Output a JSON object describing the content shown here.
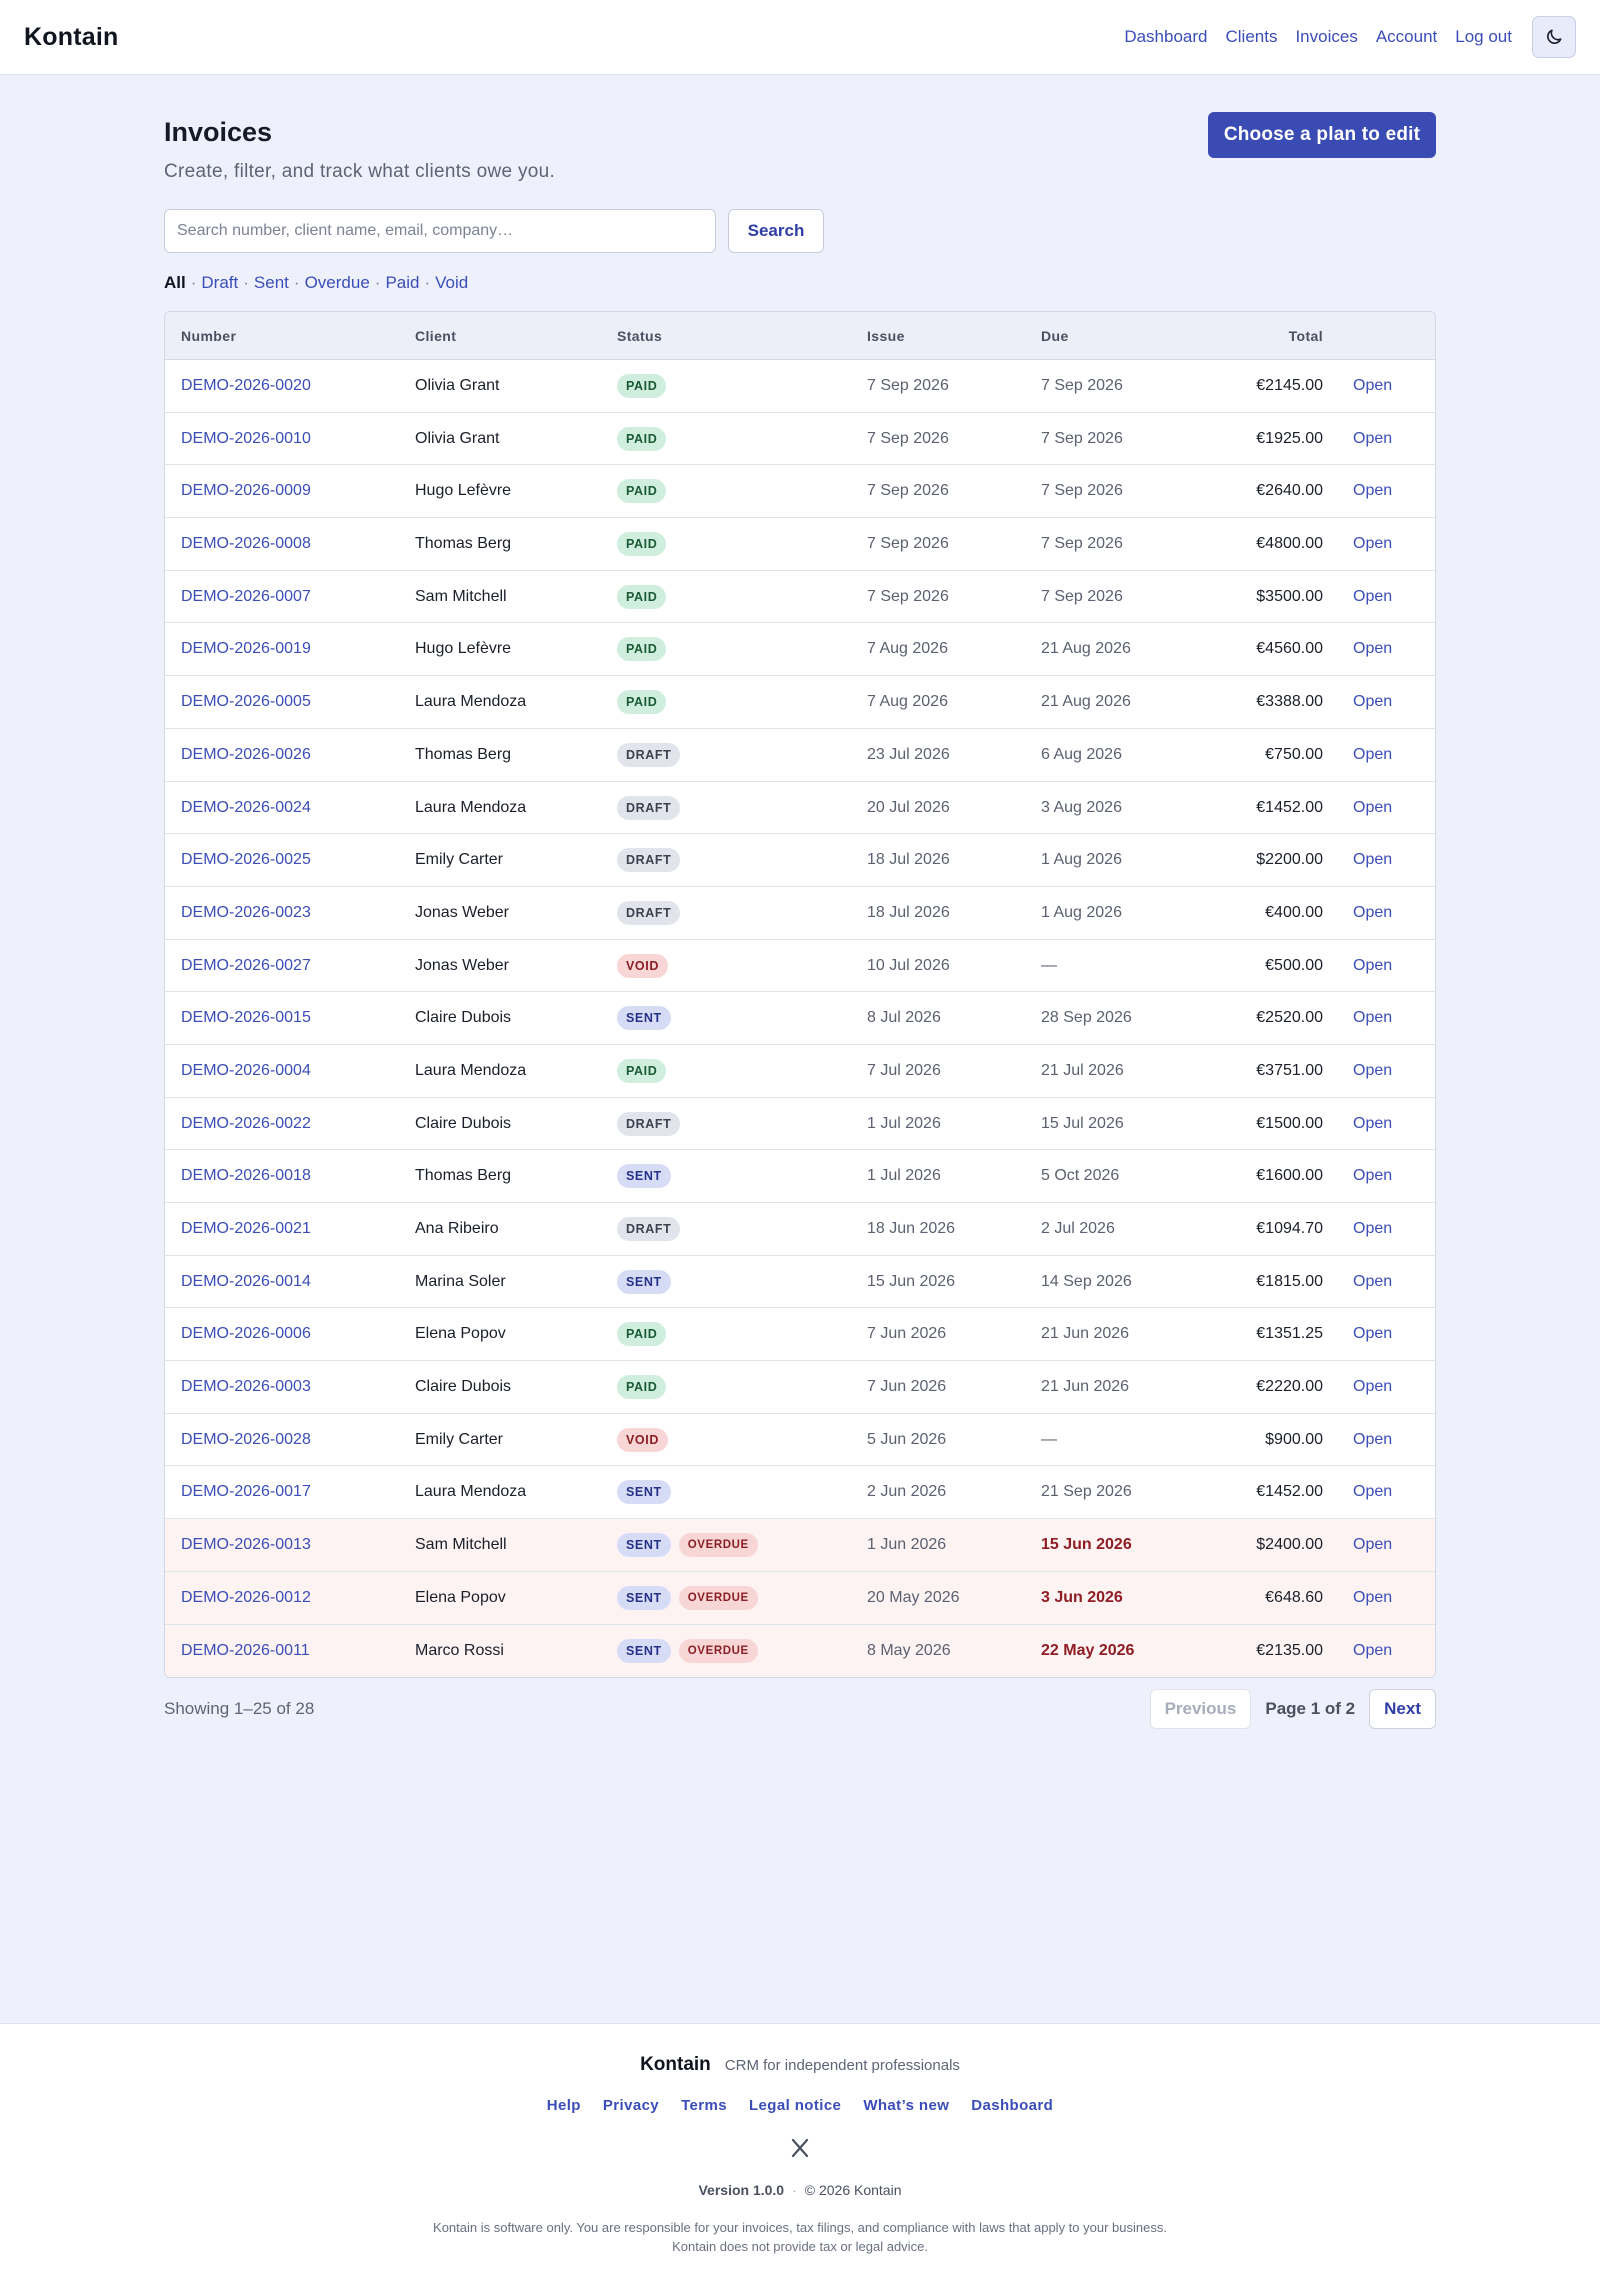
{
  "header": {
    "brand": "Kontain",
    "nav": [
      "Dashboard",
      "Clients",
      "Invoices",
      "Account",
      "Log out"
    ],
    "theme_toggle": "moon-icon"
  },
  "page": {
    "title": "Invoices",
    "subtitle": "Create, filter, and track what clients owe you.",
    "plan_button": "Choose a plan to edit"
  },
  "search": {
    "placeholder": "Search number, client name, email, company…",
    "value": "",
    "button": "Search"
  },
  "filters": {
    "active": "All",
    "items": [
      "All",
      "Draft",
      "Sent",
      "Overdue",
      "Paid",
      "Void"
    ]
  },
  "table": {
    "columns": [
      "Number",
      "Client",
      "Status",
      "Issue",
      "Due",
      "Total"
    ],
    "open_label": "Open",
    "rows": [
      {
        "number": "DEMO-2026-0020",
        "client": "Olivia Grant",
        "status": "PAID",
        "overdue": false,
        "issue": "7 Sep 2026",
        "due": "7 Sep 2026",
        "total": "€2145.00"
      },
      {
        "number": "DEMO-2026-0010",
        "client": "Olivia Grant",
        "status": "PAID",
        "overdue": false,
        "issue": "7 Sep 2026",
        "due": "7 Sep 2026",
        "total": "€1925.00"
      },
      {
        "number": "DEMO-2026-0009",
        "client": "Hugo Lefèvre",
        "status": "PAID",
        "overdue": false,
        "issue": "7 Sep 2026",
        "due": "7 Sep 2026",
        "total": "€2640.00"
      },
      {
        "number": "DEMO-2026-0008",
        "client": "Thomas Berg",
        "status": "PAID",
        "overdue": false,
        "issue": "7 Sep 2026",
        "due": "7 Sep 2026",
        "total": "€4800.00"
      },
      {
        "number": "DEMO-2026-0007",
        "client": "Sam Mitchell",
        "status": "PAID",
        "overdue": false,
        "issue": "7 Sep 2026",
        "due": "7 Sep 2026",
        "total": "$3500.00"
      },
      {
        "number": "DEMO-2026-0019",
        "client": "Hugo Lefèvre",
        "status": "PAID",
        "overdue": false,
        "issue": "7 Aug 2026",
        "due": "21 Aug 2026",
        "total": "€4560.00"
      },
      {
        "number": "DEMO-2026-0005",
        "client": "Laura Mendoza",
        "status": "PAID",
        "overdue": false,
        "issue": "7 Aug 2026",
        "due": "21 Aug 2026",
        "total": "€3388.00"
      },
      {
        "number": "DEMO-2026-0026",
        "client": "Thomas Berg",
        "status": "DRAFT",
        "overdue": false,
        "issue": "23 Jul 2026",
        "due": "6 Aug 2026",
        "total": "€750.00"
      },
      {
        "number": "DEMO-2026-0024",
        "client": "Laura Mendoza",
        "status": "DRAFT",
        "overdue": false,
        "issue": "20 Jul 2026",
        "due": "3 Aug 2026",
        "total": "€1452.00"
      },
      {
        "number": "DEMO-2026-0025",
        "client": "Emily Carter",
        "status": "DRAFT",
        "overdue": false,
        "issue": "18 Jul 2026",
        "due": "1 Aug 2026",
        "total": "$2200.00"
      },
      {
        "number": "DEMO-2026-0023",
        "client": "Jonas Weber",
        "status": "DRAFT",
        "overdue": false,
        "issue": "18 Jul 2026",
        "due": "1 Aug 2026",
        "total": "€400.00"
      },
      {
        "number": "DEMO-2026-0027",
        "client": "Jonas Weber",
        "status": "VOID",
        "overdue": false,
        "issue": "10 Jul 2026",
        "due": "—",
        "total": "€500.00"
      },
      {
        "number": "DEMO-2026-0015",
        "client": "Claire Dubois",
        "status": "SENT",
        "overdue": false,
        "issue": "8 Jul 2026",
        "due": "28 Sep 2026",
        "total": "€2520.00"
      },
      {
        "number": "DEMO-2026-0004",
        "client": "Laura Mendoza",
        "status": "PAID",
        "overdue": false,
        "issue": "7 Jul 2026",
        "due": "21 Jul 2026",
        "total": "€3751.00"
      },
      {
        "number": "DEMO-2026-0022",
        "client": "Claire Dubois",
        "status": "DRAFT",
        "overdue": false,
        "issue": "1 Jul 2026",
        "due": "15 Jul 2026",
        "total": "€1500.00"
      },
      {
        "number": "DEMO-2026-0018",
        "client": "Thomas Berg",
        "status": "SENT",
        "overdue": false,
        "issue": "1 Jul 2026",
        "due": "5 Oct 2026",
        "total": "€1600.00"
      },
      {
        "number": "DEMO-2026-0021",
        "client": "Ana Ribeiro",
        "status": "DRAFT",
        "overdue": false,
        "issue": "18 Jun 2026",
        "due": "2 Jul 2026",
        "total": "€1094.70"
      },
      {
        "number": "DEMO-2026-0014",
        "client": "Marina Soler",
        "status": "SENT",
        "overdue": false,
        "issue": "15 Jun 2026",
        "due": "14 Sep 2026",
        "total": "€1815.00"
      },
      {
        "number": "DEMO-2026-0006",
        "client": "Elena Popov",
        "status": "PAID",
        "overdue": false,
        "issue": "7 Jun 2026",
        "due": "21 Jun 2026",
        "total": "€1351.25"
      },
      {
        "number": "DEMO-2026-0003",
        "client": "Claire Dubois",
        "status": "PAID",
        "overdue": false,
        "issue": "7 Jun 2026",
        "due": "21 Jun 2026",
        "total": "€2220.00"
      },
      {
        "number": "DEMO-2026-0028",
        "client": "Emily Carter",
        "status": "VOID",
        "overdue": false,
        "issue": "5 Jun 2026",
        "due": "—",
        "total": "$900.00"
      },
      {
        "number": "DEMO-2026-0017",
        "client": "Laura Mendoza",
        "status": "SENT",
        "overdue": false,
        "issue": "2 Jun 2026",
        "due": "21 Sep 2026",
        "total": "€1452.00"
      },
      {
        "number": "DEMO-2026-0013",
        "client": "Sam Mitchell",
        "status": "SENT",
        "overdue": true,
        "issue": "1 Jun 2026",
        "due": "15 Jun 2026",
        "total": "$2400.00"
      },
      {
        "number": "DEMO-2026-0012",
        "client": "Elena Popov",
        "status": "SENT",
        "overdue": true,
        "issue": "20 May 2026",
        "due": "3 Jun 2026",
        "total": "€648.60"
      },
      {
        "number": "DEMO-2026-0011",
        "client": "Marco Rossi",
        "status": "SENT",
        "overdue": true,
        "issue": "8 May 2026",
        "due": "22 May 2026",
        "total": "€2135.00"
      }
    ],
    "overdue_label": "OVERDUE"
  },
  "pagination": {
    "showing": "Showing 1–25 of 28",
    "previous": "Previous",
    "page_label": "Page 1 of 2",
    "next": "Next"
  },
  "footer": {
    "brand": "Kontain",
    "tagline": "CRM for independent professionals",
    "links": [
      "Help",
      "Privacy",
      "Terms",
      "Legal notice",
      "What’s new",
      "Dashboard"
    ],
    "social_icon": "x-logo-icon",
    "version": "Version 1.0.0",
    "copyright": "© 2026 Kontain",
    "legal": "Kontain is software only. You are responsible for your invoices, tax filings, and compliance with laws that apply to your business. Kontain does not provide tax or legal advice."
  },
  "colors": {
    "accent": "#3a4cb3",
    "link": "#3b4db8",
    "background": "#eef1fb",
    "paid_bg": "#cfeedd",
    "draft_bg": "#e1e4ea",
    "void_bg": "#f8d6d6",
    "sent_bg": "#d7dcf6",
    "overdue_text": "#8f1d24"
  }
}
